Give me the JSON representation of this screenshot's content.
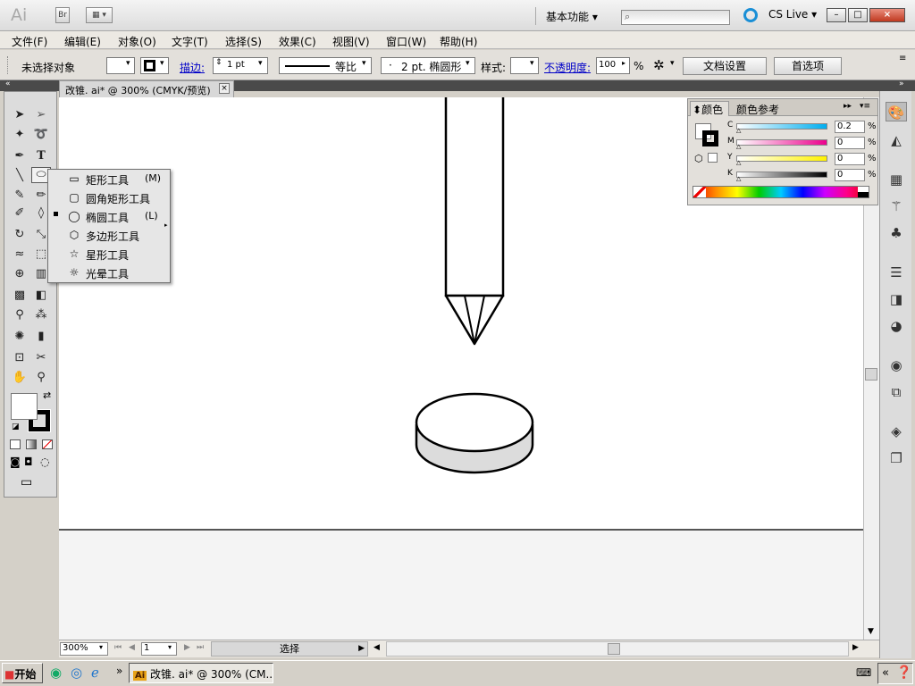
{
  "titlebar": {
    "app_logo": "Ai",
    "bridge_btn": "Br",
    "workspace": "基本功能",
    "cslive": "CS Live",
    "minimize": "–",
    "maximize": "□",
    "close": "×"
  },
  "menubar": {
    "items": [
      "文件(F)",
      "编辑(E)",
      "对象(O)",
      "文字(T)",
      "选择(S)",
      "效果(C)",
      "视图(V)",
      "窗口(W)",
      "帮助(H)"
    ]
  },
  "controlbar": {
    "selection_status": "未选择对象",
    "stroke_label": "描边:",
    "stroke_weight": "1 pt",
    "stroke_profile": "等比",
    "brush": "2 pt. 椭圆形",
    "style_label": "样式:",
    "opacity_label": "不透明度:",
    "opacity_value": "100",
    "opacity_unit": "%",
    "doc_setup": "文档设置",
    "prefs": "首选项"
  },
  "document": {
    "tab_title": "改锥. ai* @ 300% (CMYK/预览)",
    "zoom": "300%",
    "page": "1",
    "status": "选择"
  },
  "flyout": {
    "items": [
      {
        "label": "矩形工具",
        "key": "(M)",
        "icon": "rectangle-icon"
      },
      {
        "label": "圆角矩形工具",
        "key": "",
        "icon": "rounded-rectangle-icon"
      },
      {
        "label": "椭圆工具",
        "key": "(L)",
        "icon": "ellipse-icon",
        "selected": true
      },
      {
        "label": "多边形工具",
        "key": "",
        "icon": "polygon-icon"
      },
      {
        "label": "星形工具",
        "key": "",
        "icon": "star-icon"
      },
      {
        "label": "光晕工具",
        "key": "",
        "icon": "flare-icon"
      }
    ]
  },
  "colorpanel": {
    "tab_color": "颜色",
    "tab_guide": "颜色参考",
    "channels": [
      {
        "name": "C",
        "value": "0.2",
        "pct": "%"
      },
      {
        "name": "M",
        "value": "0",
        "pct": "%"
      },
      {
        "name": "Y",
        "value": "0",
        "pct": "%"
      },
      {
        "name": "K",
        "value": "0",
        "pct": "%"
      }
    ]
  },
  "taskbar": {
    "start": "开始",
    "task": "改锥. ai* @ 300% (CM..."
  }
}
